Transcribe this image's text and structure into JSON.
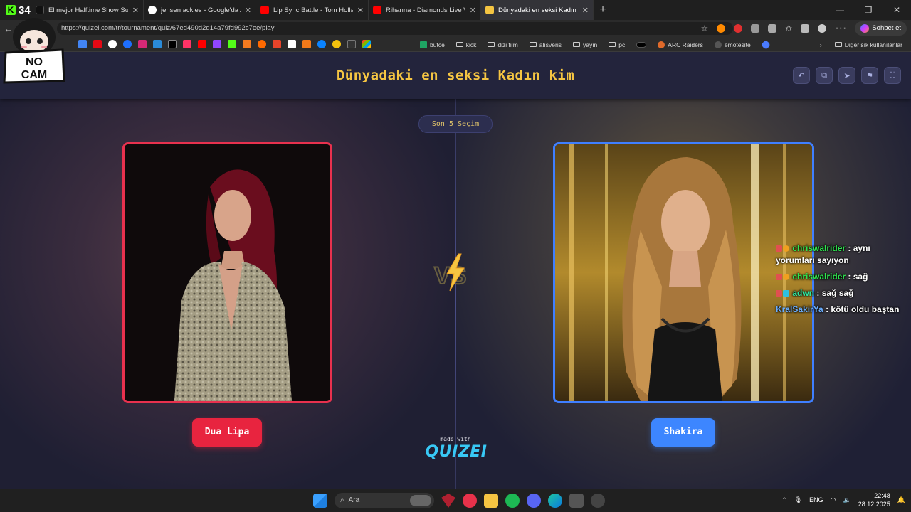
{
  "browser": {
    "kick_count": "34",
    "tabs": [
      {
        "title": "El mejor Halftime Show Super Bow",
        "color": "#000000"
      },
      {
        "title": "jensen ackles - Google'da Ara",
        "color": "#4285f4"
      },
      {
        "title": "Lip Sync Battle - Tom Holland - Yo",
        "color": "#ff0000"
      },
      {
        "title": "Rihanna - Diamonds Live Victoria'",
        "color": "#ff0000"
      },
      {
        "title": "Dünyadaki en seksi Kadın kim - Tü",
        "color": "#f5c542"
      }
    ],
    "url": "https://quizei.com/tr/tournament/quiz/67ed490d2d14a79fd992c7ee/play",
    "chat_button": "Sohbet et",
    "bookmark_folders": [
      "butce",
      "kick",
      "dizi film",
      "alısveris",
      "yayın",
      "pc"
    ],
    "bookmark_arc": "ARC Raiders",
    "bookmark_emote": "emotesite",
    "other_bookmarks": "Diğer sık kullanılanlar"
  },
  "page": {
    "title": "Dünyadaki en seksi Kadın kim",
    "history_pill": "Son 5 Seçim",
    "left_name": "Dua Lipa",
    "right_name": "Shakira",
    "made_with": "made with",
    "brand": "QUIZEI",
    "accent_left": "#e8243f",
    "accent_right": "#3d86ff",
    "title_color": "#f5c542"
  },
  "chat": [
    {
      "user": "chriswalrider",
      "text": ": aynı yorumları sayıyon"
    },
    {
      "user": "chriswalrider",
      "text": ": sağ"
    },
    {
      "user": "adwn",
      "text": ": sağ sağ"
    },
    {
      "user": "KralSakirYa",
      "text": ": kötü oldu baştan"
    }
  ],
  "sticker": {
    "line1": "NO",
    "line2": "CAM"
  },
  "taskbar": {
    "search": "Ara",
    "lang": "ENG",
    "time": "22:48",
    "date": "28.12.2025"
  }
}
